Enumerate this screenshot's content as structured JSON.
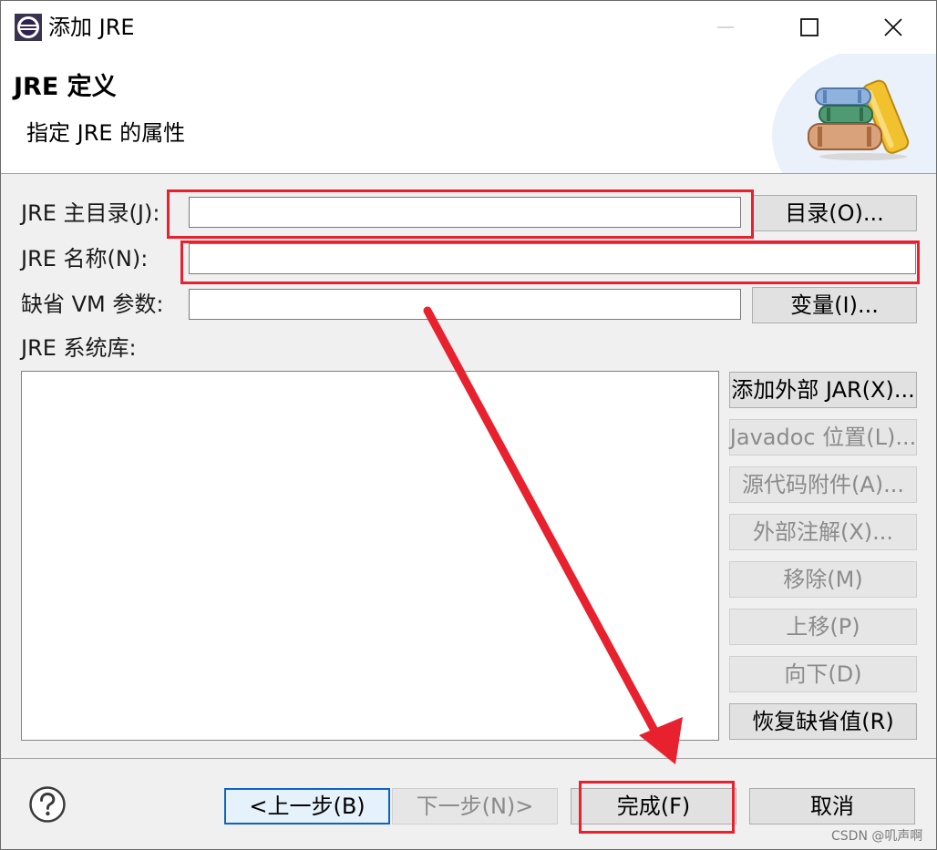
{
  "window": {
    "title": "添加 JRE",
    "controls": [
      "minimize",
      "maximize",
      "close"
    ]
  },
  "header": {
    "title": "JRE 定义",
    "subtitle": "指定 JRE 的属性",
    "icon": "library-books-icon"
  },
  "form": {
    "jre_home_label": "JRE 主目录(J):",
    "jre_home_value": "",
    "directory_button": "目录(O)...",
    "jre_name_label": "JRE 名称(N):",
    "jre_name_value": "",
    "default_vm_args_label": "缺省 VM 参数:",
    "default_vm_args_value": "",
    "variables_button": "变量(I)...",
    "system_libraries_label": "JRE 系统库:",
    "system_libraries_items": []
  },
  "library_buttons": [
    {
      "label": "添加外部 JAR(X)...",
      "enabled": true
    },
    {
      "label": "Javadoc 位置(L)...",
      "enabled": false
    },
    {
      "label": "源代码附件(A)...",
      "enabled": false
    },
    {
      "label": "外部注解(X)...",
      "enabled": false
    },
    {
      "label": "移除(M)",
      "enabled": false
    },
    {
      "label": "上移(P)",
      "enabled": false
    },
    {
      "label": "向下(D)",
      "enabled": false
    },
    {
      "label": "恢复缺省值(R)",
      "enabled": true
    }
  ],
  "footer": {
    "back_button": "<上一步(B)",
    "next_button": "下一步(N)>",
    "finish_button": "完成(F)",
    "cancel_button": "取消"
  },
  "watermark": "CSDN @叽声啊",
  "colors": {
    "annotation_red": "#e8212e",
    "focus_blue": "#0a64c8",
    "dialog_bg": "#f0f0f0"
  }
}
